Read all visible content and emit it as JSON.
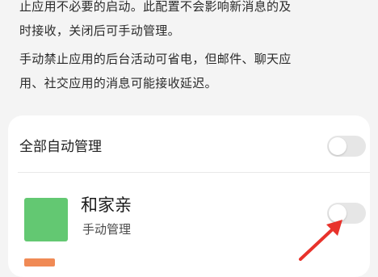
{
  "description": {
    "line1": "止应用不必要的启动。此配置不会影响新消息的及",
    "line2": "时接收，关闭后可手动管理。",
    "para2_line1": "手动禁止应用的后台活动可省电，但邮件、聊天应",
    "para2_line2": "用、社交应用的消息可能接收延迟。"
  },
  "settings": {
    "all_auto_label": "全部自动管理",
    "all_auto_enabled": false,
    "app": {
      "name": "和家亲",
      "status": "手动管理",
      "auto_enabled": false,
      "icon": "app-icon-green"
    }
  },
  "colors": {
    "background": "#f4f4f4",
    "card": "#ffffff",
    "toggle_off": "#e6e6e6",
    "app_icon": "#63c872",
    "arrow": "#e8322b"
  }
}
